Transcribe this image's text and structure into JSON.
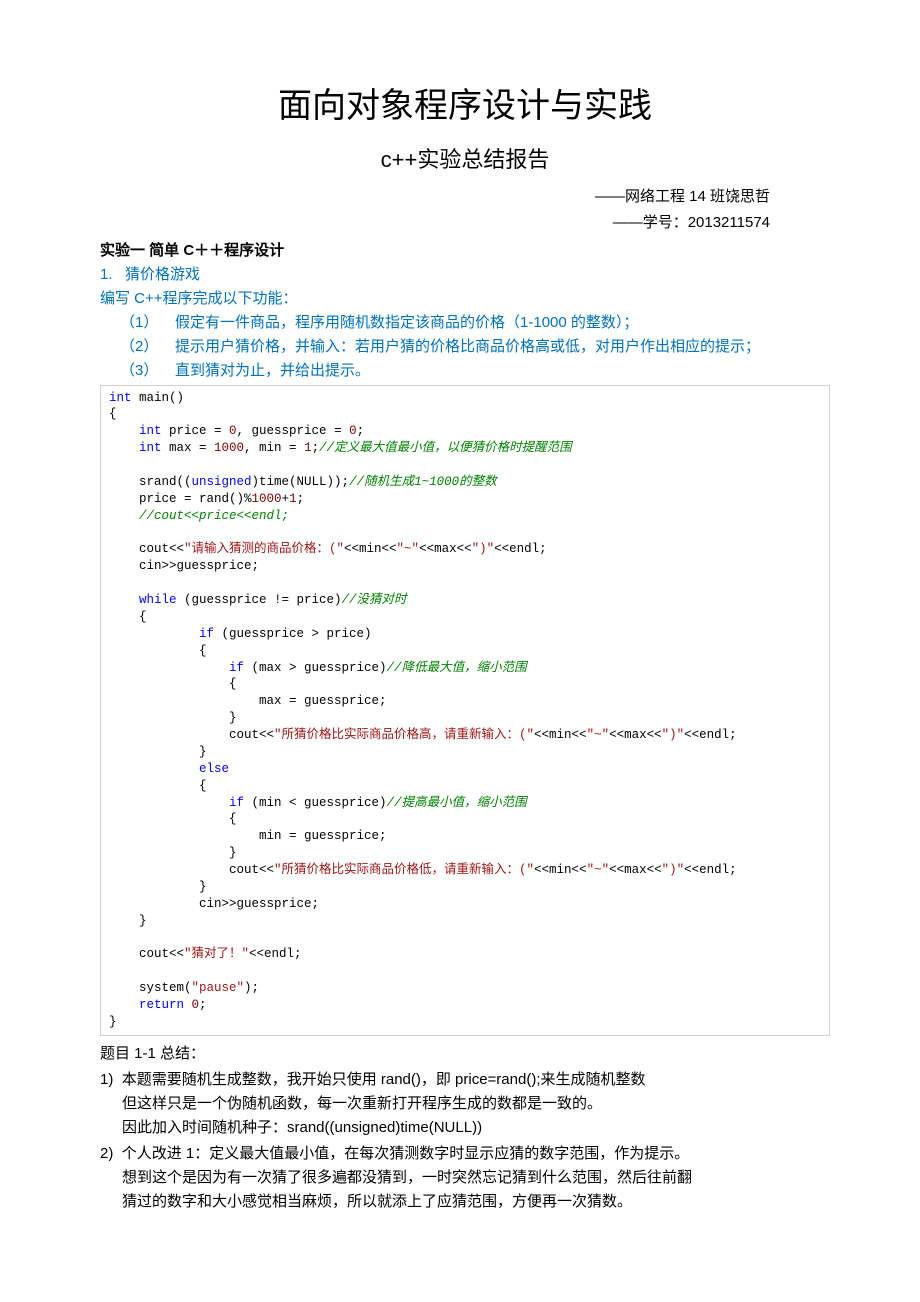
{
  "title": "面向对象程序设计与实践",
  "subtitle": "c++实验总结报告",
  "meta_line1": "——网络工程 14 班饶思哲",
  "meta_line2": "——学号：2013211574",
  "section_header": "实验一 简单 C＋＋程序设计",
  "task_no": "1.",
  "task_title": "猜价格游戏",
  "task_intro": "编写 C++程序完成以下功能：",
  "req1_no": "（1）",
  "req1_text": "假定有一件商品，程序用随机数指定该商品的价格（1-1000 的整数）；",
  "req2_no": "（2）",
  "req2_text": "提示用户猜价格，并输入：若用户猜的价格比商品价格高或低，对用户作出相应的提示；",
  "req3_no": "（3）",
  "req3_text": "直到猜对为止，并给出提示。",
  "code": {
    "l1a": "int",
    "l1b": " main()",
    "l2": "{",
    "l3a": "    int",
    "l3b": " price = ",
    "l3c": "0",
    "l3d": ", guessprice = ",
    "l3e": "0",
    "l3f": ";",
    "l4a": "    int",
    "l4b": " max = ",
    "l4c": "1000",
    "l4d": ", min = ",
    "l4e": "1",
    "l4f": ";",
    "l4g": "//定义最大值最小值，以便猜价格时提醒范围",
    "l5": "",
    "l6a": "    srand((",
    "l6b": "unsigned",
    "l6c": ")time(NULL));",
    "l6d": "//随机生成1~1000的整数",
    "l7a": "    price = rand()%",
    "l7b": "1000",
    "l7c": "+",
    "l7d": "1",
    "l7e": ";",
    "l8": "    //cout<<price<<endl;",
    "l9": "",
    "l10a": "    cout<<",
    "l10b": "\"请输入猜测的商品价格：(\"",
    "l10c": "<<min<<",
    "l10d": "\"~\"",
    "l10e": "<<max<<",
    "l10f": "\")\"",
    "l10g": "<<endl;",
    "l11": "    cin>>guessprice;",
    "l12": "",
    "l13a": "    while",
    "l13b": " (guessprice != price)",
    "l13c": "//没猜对时",
    "l14": "    {",
    "l15a": "            if",
    "l15b": " (guessprice > price)",
    "l16": "            {",
    "l17a": "                if",
    "l17b": " (max > guessprice)",
    "l17c": "//降低最大值，缩小范围",
    "l18": "                {",
    "l19": "                    max = guessprice;",
    "l20": "                }",
    "l21a": "                cout<<",
    "l21b": "\"所猜价格比实际商品价格高，请重新输入：(\"",
    "l21c": "<<min<<",
    "l21d": "\"~\"",
    "l21e": "<<max<<",
    "l21f": "\")\"",
    "l21g": "<<endl;",
    "l22": "            }",
    "l23a": "            else",
    "l24": "            {",
    "l25a": "                if",
    "l25b": " (min < guessprice)",
    "l25c": "//提高最小值，缩小范围",
    "l26": "                {",
    "l27": "                    min = guessprice;",
    "l28": "                }",
    "l29a": "                cout<<",
    "l29b": "\"所猜价格比实际商品价格低，请重新输入：(\"",
    "l29c": "<<min<<",
    "l29d": "\"~\"",
    "l29e": "<<max<<",
    "l29f": "\")\"",
    "l29g": "<<endl;",
    "l30": "            }",
    "l31": "            cin>>guessprice;",
    "l32": "    }",
    "l33": "",
    "l34a": "    cout<<",
    "l34b": "\"猜对了！\"",
    "l34c": "<<endl;",
    "l35": "",
    "l36a": "    system(",
    "l36b": "\"pause\"",
    "l36c": ");",
    "l37a": "    return",
    "l37b": " ",
    "l37c": "0",
    "l37d": ";",
    "l38": "}"
  },
  "summary_title": "题目 1-1 总结：",
  "s1_no": "1)",
  "s1_l1": "本题需要随机生成整数，我开始只使用 rand()，即 price=rand();来生成随机整数",
  "s1_l2": "但这样只是一个伪随机函数，每一次重新打开程序生成的数都是一致的。",
  "s1_l3": "因此加入时间随机种子：srand((unsigned)time(NULL))",
  "s2_no": "2)",
  "s2_l1": "个人改进 1：定义最大值最小值，在每次猜测数字时显示应猜的数字范围，作为提示。",
  "s2_l2": "想到这个是因为有一次猜了很多遍都没猜到，一时突然忘记猜到什么范围，然后往前翻",
  "s2_l3": "猜过的数字和大小感觉相当麻烦，所以就添上了应猜范围，方便再一次猜数。"
}
